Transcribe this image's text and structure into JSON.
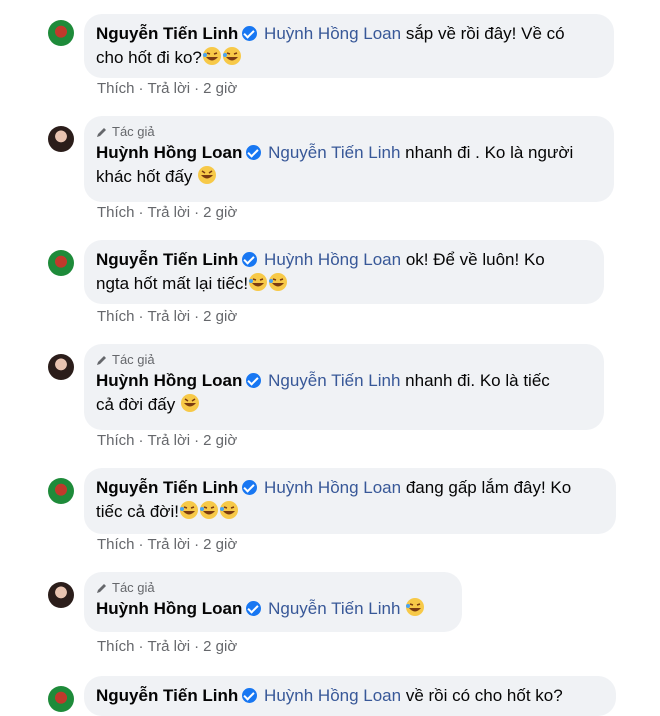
{
  "labels": {
    "author": "Tác giả",
    "like": "Thích",
    "reply": "Trả lời",
    "sep": "·"
  },
  "people": {
    "linh": "Nguyễn Tiến Linh",
    "loan": "Huỳnh Hồng Loan"
  },
  "comments": [
    {
      "time": "2 giờ",
      "l1": "sắp về rồi đây! Về có",
      "l2": "cho hốt đi ko?"
    },
    {
      "time": "2 giờ",
      "l1": "nhanh đi . Ko là người",
      "l2": "khác hốt đấy"
    },
    {
      "time": "2 giờ",
      "l1": "ok! Để về luôn! Ko",
      "l2": "ngta hốt mất lại tiếc!"
    },
    {
      "time": "2 giờ",
      "l1": "nhanh đi. Ko là tiếc",
      "l2": "cả đời đấy"
    },
    {
      "time": "2 giờ",
      "l1": "đang gấp lắm đây! Ko",
      "l2": "tiếc cả đời!"
    },
    {
      "time": "2 giờ",
      "l1": ""
    },
    {
      "l1": "về rồi có cho hốt ko?"
    }
  ]
}
